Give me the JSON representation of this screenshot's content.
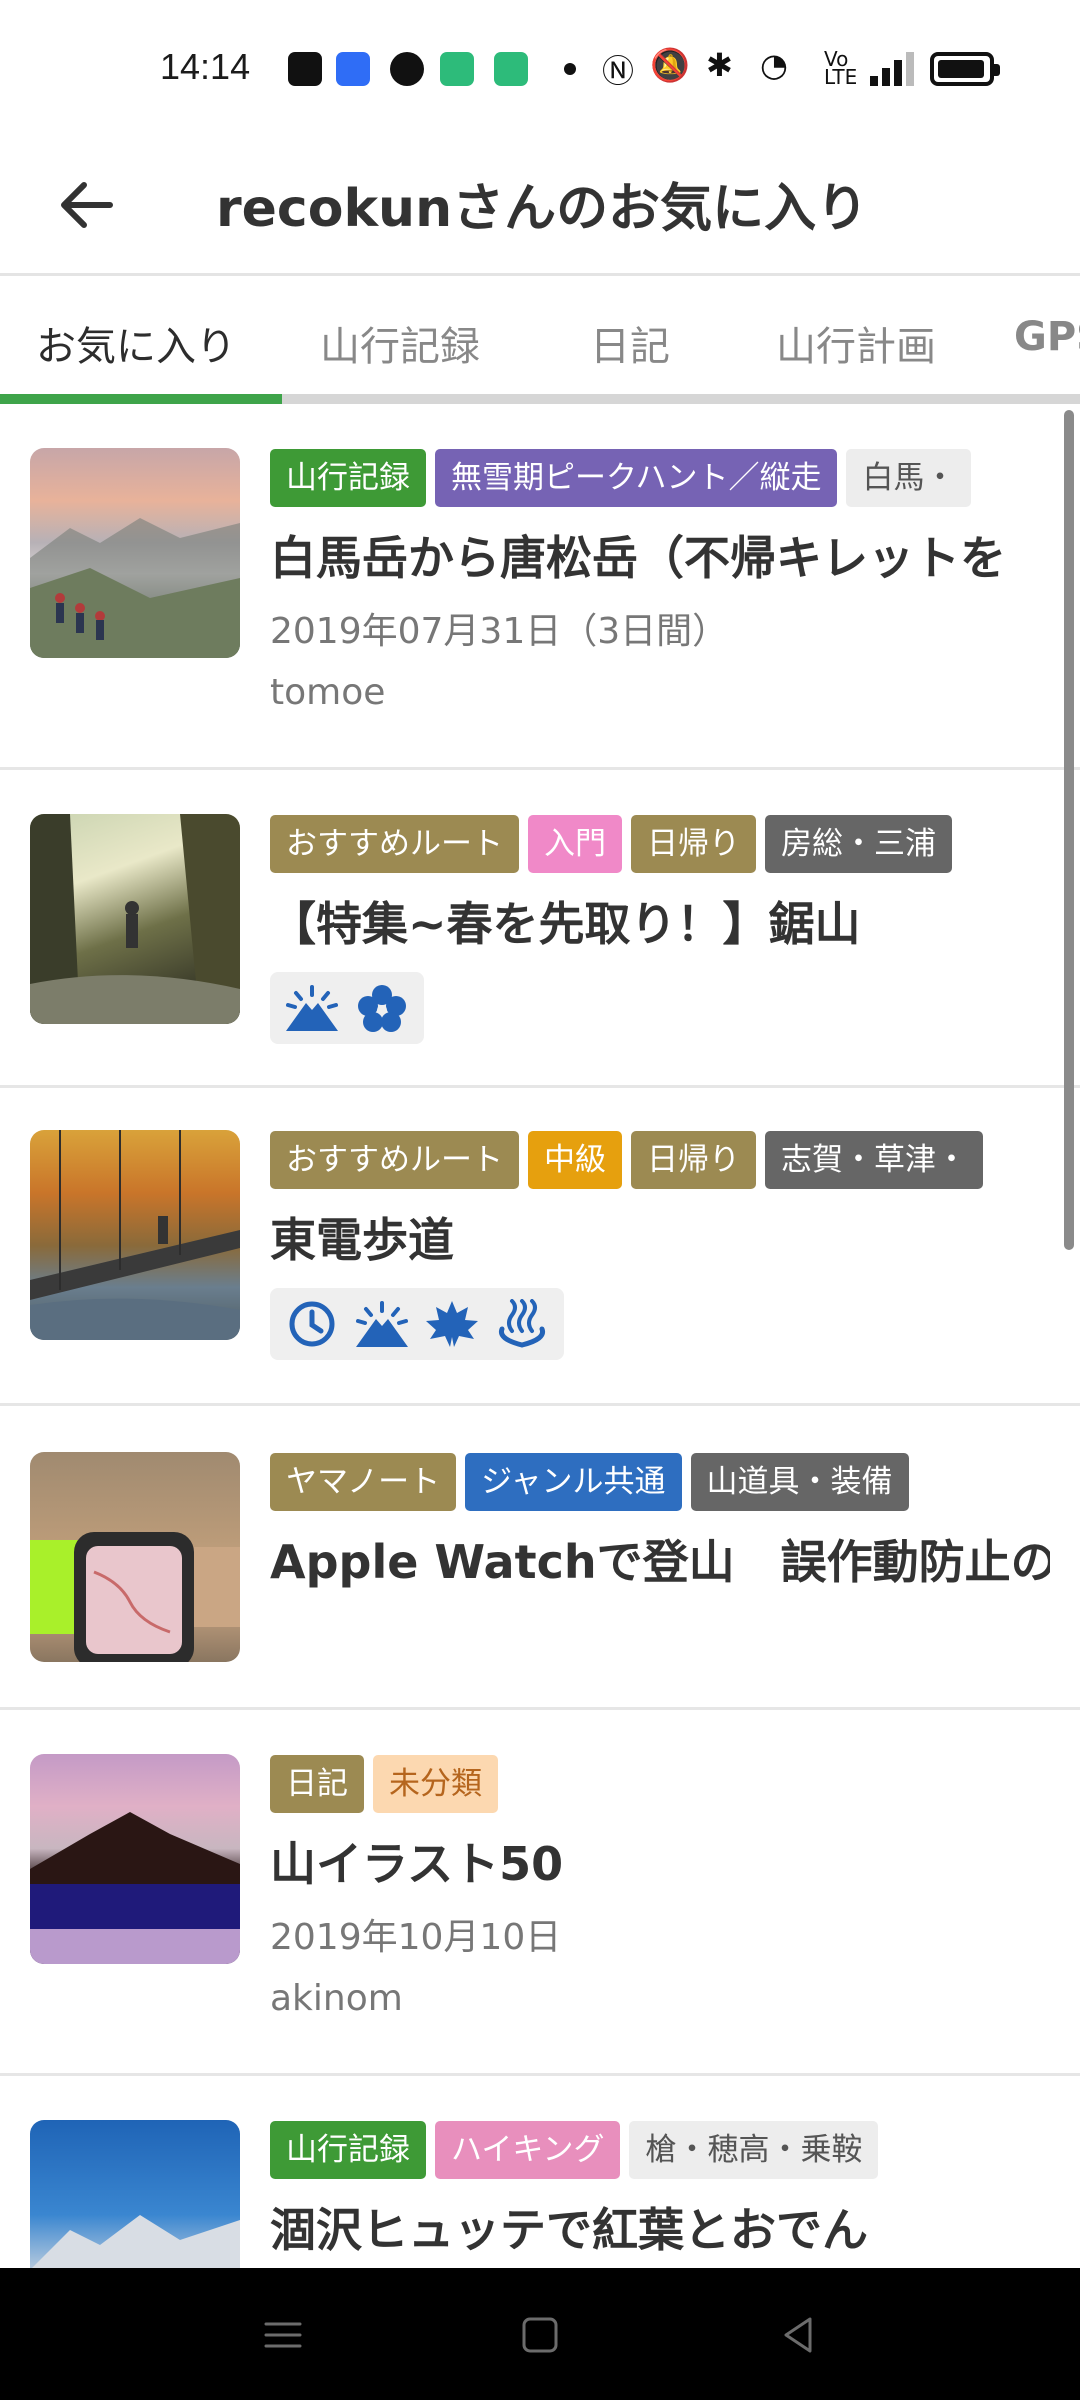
{
  "status_bar": {
    "time": "14:14",
    "icons": [
      "message-icon",
      "nfc-broadcast-icon",
      "facebook-icon",
      "data-app-icon",
      "battery-app-icon",
      "notification-dot",
      "nfc-icon",
      "mute-icon",
      "bluetooth-icon",
      "wifi-icon",
      "volte-icon",
      "signal-icon",
      "battery-icon"
    ]
  },
  "header": {
    "title": "recokunさんのお気に入り",
    "back_icon": "arrow-left-icon"
  },
  "tabs": [
    {
      "label": "お気に入り",
      "active": true
    },
    {
      "label": "山行記録",
      "active": false
    },
    {
      "label": "日記",
      "active": false
    },
    {
      "label": "山行計画",
      "active": false
    },
    {
      "label": "GPS",
      "active": false
    }
  ],
  "items": [
    {
      "tags": [
        "山行記録",
        "無雪期ピークハント／縦走",
        "白馬・"
      ],
      "title": "白馬岳から唐松岳（不帰キレットを",
      "date": "2019年07月31日（3日間）",
      "user": "tomoe"
    },
    {
      "tags": [
        "おすすめルート",
        "入門",
        "日帰り",
        "房総・三浦"
      ],
      "title": "【特集~春を先取り！】鋸山",
      "features": [
        "mountain-view-icon",
        "flower-icon"
      ]
    },
    {
      "tags": [
        "おすすめルート",
        "中級",
        "日帰り",
        "志賀・草津・"
      ],
      "title": "東電歩道",
      "features": [
        "clock-icon",
        "mountain-view-icon",
        "autumn-leaf-icon",
        "hot-spring-icon"
      ]
    },
    {
      "tags": [
        "ヤマノート",
        "ジャンル共通",
        "山道具・装備"
      ],
      "title": "Apple Watchで登山　誤作動防止の"
    },
    {
      "tags": [
        "日記",
        "未分類"
      ],
      "title": "山イラスト50",
      "date": "2019年10月10日",
      "user": "akinom"
    },
    {
      "tags": [
        "山行記録",
        "ハイキング",
        "槍・穂高・乗鞍"
      ],
      "title": "涸沢ヒュッテで紅葉とおでん"
    }
  ],
  "nav_bar": {
    "icons": [
      "menu-icon",
      "home-icon",
      "back-triangle-icon"
    ]
  },
  "colors": {
    "accent_green": "#3ea44a",
    "tag_record": "#3e9a36",
    "tag_recommended": "#9c8a52",
    "tag_genre": "#2e6ec0"
  }
}
